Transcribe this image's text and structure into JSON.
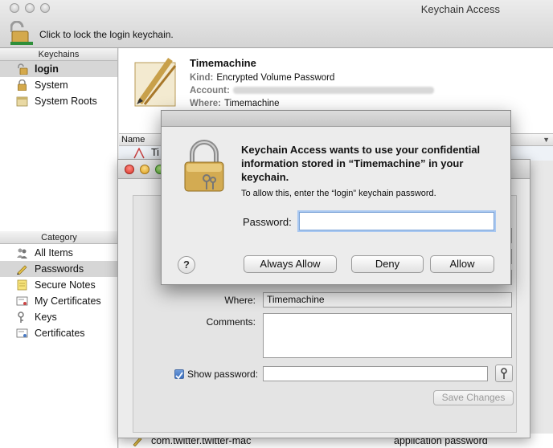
{
  "window": {
    "title": "Keychain Access",
    "lock_hint": "Click to lock the login keychain."
  },
  "sidebar": {
    "keychains_header": "Keychains",
    "keychains": [
      {
        "label": "login",
        "icon": "lock-open-icon"
      },
      {
        "label": "System",
        "icon": "lock-icon"
      },
      {
        "label": "System Roots",
        "icon": "folder-icon"
      }
    ],
    "category_header": "Category",
    "categories": [
      {
        "label": "All Items",
        "icon": "people-icon"
      },
      {
        "label": "Passwords",
        "icon": "pencil-icon"
      },
      {
        "label": "Secure Notes",
        "icon": "note-icon"
      },
      {
        "label": "My Certificates",
        "icon": "certificate-icon"
      },
      {
        "label": "Keys",
        "icon": "key-icon"
      },
      {
        "label": "Certificates",
        "icon": "certificate-icon"
      }
    ]
  },
  "detail": {
    "title": "Timemachine",
    "kind_label": "Kind:",
    "kind_value": "Encrypted Volume Password",
    "account_label": "Account:",
    "where_label": "Where:",
    "where_value": "Timemachine"
  },
  "list": {
    "column_name": "Name",
    "rows": [
      {
        "name": "Ti"
      },
      {
        "name": "com.twitter.twitter-mac",
        "kind": "application password"
      }
    ]
  },
  "item_window": {
    "where_label": "Where:",
    "where_value": "Timemachine",
    "comments_label": "Comments:",
    "show_password_label": "Show password:",
    "save_button": "Save Changes"
  },
  "sheet": {
    "message": "Keychain Access wants to use your confidential information stored in “Timemachine” in your keychain.",
    "sub": "To allow this, enter the “login” keychain password.",
    "password_label": "Password:",
    "password_value": "",
    "help": "?",
    "always_allow": "Always Allow",
    "deny": "Deny",
    "allow": "Allow"
  },
  "colors": {
    "selection": "#d6d6d6",
    "focus_ring": "#a9c8f1",
    "lock_gold": "#c9a24a"
  }
}
